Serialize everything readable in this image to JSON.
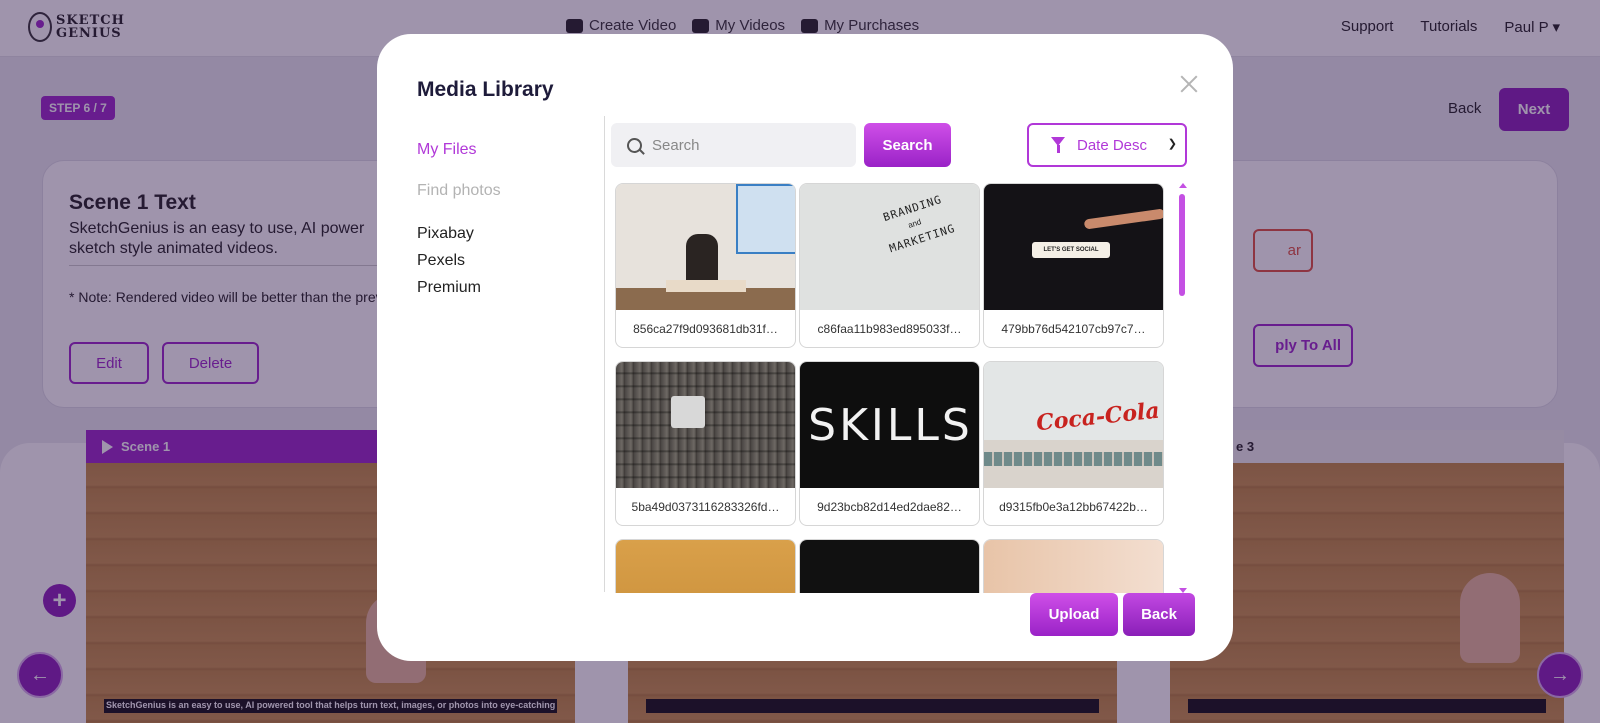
{
  "app": {
    "logo_text_line1": "SKETCH",
    "logo_text_line2": "GENIUS",
    "nav": [
      {
        "label": "Create Video",
        "icon": "video-camera-icon"
      },
      {
        "label": "My Videos",
        "icon": "list-icon"
      },
      {
        "label": "My Purchases",
        "icon": "shopping-cart-icon"
      }
    ],
    "right_nav": {
      "support": "Support",
      "tutorials": "Tutorials",
      "user": "Paul P ▾"
    },
    "step_badge": "STEP 6 / 7",
    "back_label": "Back",
    "next_label": "Next"
  },
  "scene_panel": {
    "title": "Scene 1 Text",
    "description": "SketchGenius is an easy to use, AI powered tool that helps turn text, images, or photos into eye-catching sketch style animated videos.",
    "note": "* Note: Rendered video will be better than the preview",
    "edit_label": "Edit",
    "delete_label": "Delete",
    "clear_label": "ar",
    "apply_label": "ply To All"
  },
  "timeline": {
    "scene1_label": "Scene 1",
    "scene3_label": "e 3",
    "caption1": "SketchGenius is an easy to use, AI powered tool that helps turn text, images, or photos into eye-catching sketch style animated",
    "caption2": "",
    "caption3": ""
  },
  "modal": {
    "title": "Media Library",
    "sidebar": {
      "my_files": "My Files",
      "find_photos": "Find photos",
      "sources": [
        "Pixabay",
        "Pexels",
        "Premium"
      ]
    },
    "search_placeholder": "Search",
    "search_button": "Search",
    "sort_value": "Date Desc",
    "items": [
      {
        "name": "856ca27f9d093681db31f…",
        "icon": "classroom-photo"
      },
      {
        "name": "c86faa11b983ed895033f…",
        "icon": "branding-marketing-photo"
      },
      {
        "name": "479bb76d542107cb97c7…",
        "icon": "lets-get-social-photo"
      },
      {
        "name": "5ba49d0373116283326fd…",
        "icon": "building-sign-photo"
      },
      {
        "name": "9d23bcb82d14ed2dae82…",
        "icon": "skills-chalkboard-photo"
      },
      {
        "name": "d9315fb0e3a12bb67422b…",
        "icon": "coca-cola-building-photo"
      }
    ],
    "upload_button": "Upload",
    "back_button": "Back",
    "colors": {
      "accent": "#b138d8",
      "accent_dark": "#8a1fb8"
    }
  }
}
